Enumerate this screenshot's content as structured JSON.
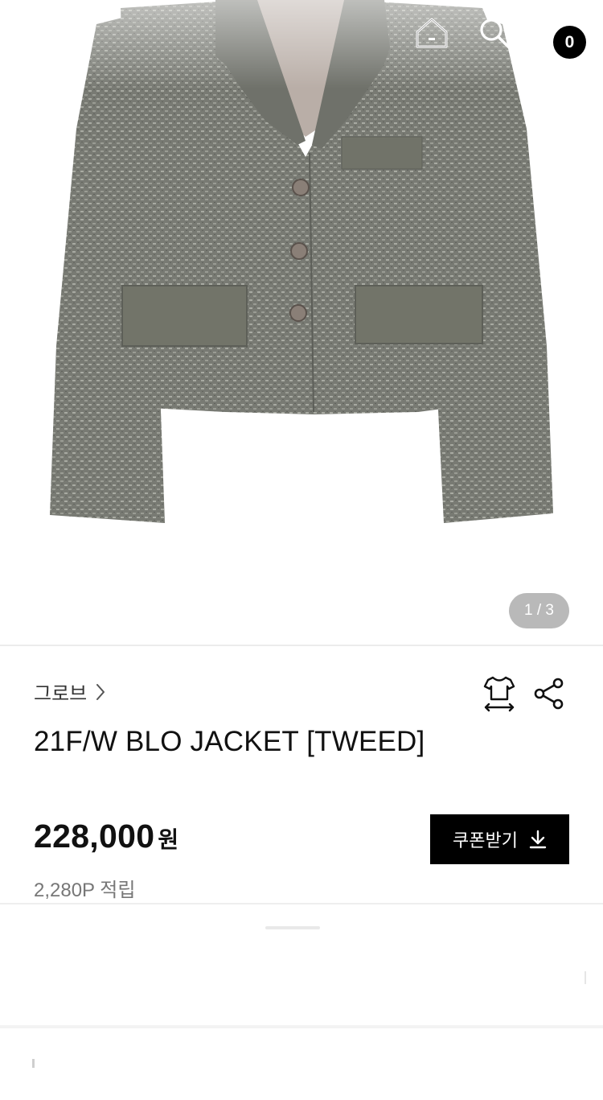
{
  "header": {
    "back_icon": "arrow-left-icon",
    "home_icon": "home-icon",
    "search_icon": "search-icon",
    "cart_icon": "shopping-bag-icon",
    "cart_count": "0"
  },
  "gallery": {
    "image_subject": "gray tweed cropped jacket",
    "indicator": "1 / 3"
  },
  "product": {
    "brand": "그로브",
    "title": "21F/W BLO JACKET [TWEED]",
    "price": "228,000",
    "currency": "원",
    "points": "2,280P 적립",
    "size_icon": "tshirt-size-icon",
    "share_icon": "share-icon"
  },
  "coupon": {
    "label": "쿠폰받기",
    "icon": "download-icon"
  },
  "colors": {
    "accent": "#000000",
    "indicator_bg": "#b9b9b9",
    "muted_text": "#777777",
    "jacket": "#7a7c75"
  }
}
